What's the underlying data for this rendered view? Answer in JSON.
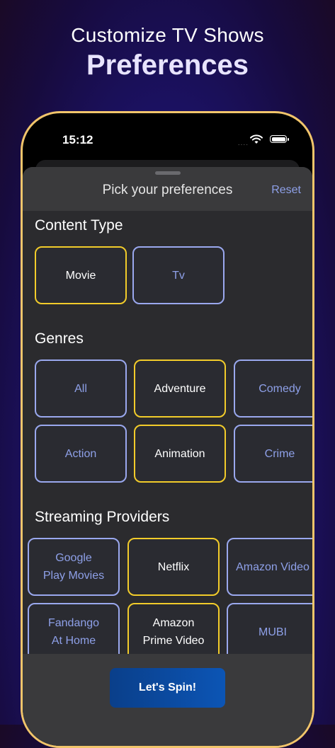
{
  "promo": {
    "line1": "Customize TV Shows",
    "line2": "Preferences"
  },
  "status_bar": {
    "time": "15:12",
    "cellular": "....",
    "wifi_icon": "wifi-icon",
    "battery_icon": "battery-icon"
  },
  "sheet": {
    "title": "Pick your preferences",
    "reset_label": "Reset"
  },
  "content_type": {
    "title": "Content Type",
    "options": [
      {
        "label": "Movie",
        "selected": true
      },
      {
        "label": "Tv",
        "selected": false
      }
    ]
  },
  "genres": {
    "title": "Genres",
    "options": [
      {
        "label": "All",
        "selected": false
      },
      {
        "label": "Adventure",
        "selected": true
      },
      {
        "label": "Comedy",
        "selected": false
      },
      {
        "label": "Action",
        "selected": false
      },
      {
        "label": "Animation",
        "selected": true
      },
      {
        "label": "Crime",
        "selected": false
      }
    ]
  },
  "providers": {
    "title": "Streaming Providers",
    "options": [
      {
        "label": "Google\nPlay Movies",
        "selected": false
      },
      {
        "label": "Netflix",
        "selected": true
      },
      {
        "label": "Amazon Video",
        "selected": false
      },
      {
        "label": "Fandango\nAt Home",
        "selected": false
      },
      {
        "label": "Amazon\nPrime Video",
        "selected": true
      },
      {
        "label": "MUBI",
        "selected": false
      }
    ]
  },
  "primary_action": {
    "label": "Let's Spin!"
  },
  "colors": {
    "selected_border": "#f2cc2a",
    "unselected_border": "#9aa8ee",
    "accent": "#8ea0e8",
    "button": "#0c55b5"
  }
}
